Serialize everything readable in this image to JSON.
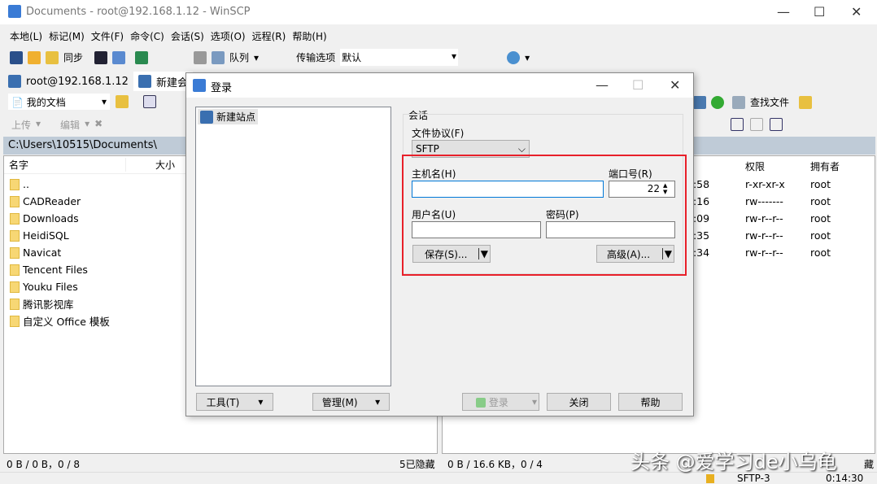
{
  "window": {
    "title": "Documents - root@192.168.1.12 - WinSCP",
    "min": "—",
    "max": "☐",
    "close": "✕"
  },
  "menu": [
    "本地(L)",
    "标记(M)",
    "文件(F)",
    "命令(C)",
    "会话(S)",
    "选项(O)",
    "远程(R)",
    "帮助(H)"
  ],
  "toolbar": {
    "sync": "同步",
    "queue": "队列",
    "transfer_label": "传输选项",
    "transfer_value": "默认"
  },
  "tabs": [
    {
      "label": "root@192.168.1.12",
      "close": "✕"
    },
    {
      "label": "新建会"
    }
  ],
  "local": {
    "location": "我的文档",
    "upload": "上传",
    "edit": "编辑",
    "path": "C:\\Users\\10515\\Documents\\",
    "columns": [
      "名字",
      "大小"
    ],
    "files": [
      "..",
      "CADReader",
      "Downloads",
      "HeidiSQL",
      "Navicat",
      "Tencent Files",
      "Youku Files",
      "腾讯影视库",
      "自定义 Office 模板"
    ],
    "status": "0 B / 0 B，0 / 8",
    "hidden": "5已隐藏"
  },
  "remote": {
    "find": "查找文件",
    "columns": [
      "权限",
      "拥有者"
    ],
    "rows": [
      {
        "time": "8:58",
        "perm": "r-xr-xr-x",
        "owner": "root"
      },
      {
        "time": "5:16",
        "perm": "rw-------",
        "owner": "root"
      },
      {
        "time": "5:09",
        "perm": "rw-r--r--",
        "owner": "root"
      },
      {
        "time": "8:35",
        "perm": "rw-r--r--",
        "owner": "root"
      },
      {
        "time": "8:34",
        "perm": "rw-r--r--",
        "owner": "root"
      }
    ],
    "status": "0 B / 16.6 KB，0 / 4",
    "hidden": "藏"
  },
  "statusbar": {
    "protocol": "SFTP-3",
    "time": "0:14:30"
  },
  "watermark": "头条 @爱学习de小乌龟",
  "dialog": {
    "title": "登录",
    "site": "新建站点",
    "group": "会话",
    "protocol_label": "文件协议(F)",
    "protocol": "SFTP",
    "host_label": "主机名(H)",
    "host": "",
    "port_label": "端口号(R)",
    "port": "22",
    "user_label": "用户名(U)",
    "user": "",
    "pass_label": "密码(P)",
    "pass": "",
    "save": "保存(S)...",
    "advanced": "高级(A)...",
    "tools": "工具(T)",
    "manage": "管理(M)",
    "login": "登录",
    "close": "关闭",
    "help": "帮助",
    "highlight_color": "#e8202a"
  }
}
